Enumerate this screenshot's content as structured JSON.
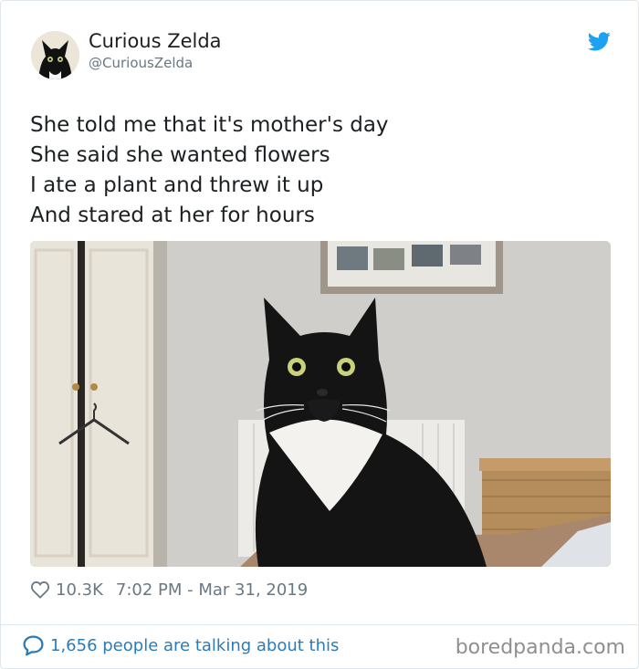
{
  "author": {
    "display_name": "Curious Zelda",
    "handle": "@CuriousZelda"
  },
  "tweet": {
    "lines": [
      "She told me that it's mother's day",
      "She said she wanted flowers",
      "I ate a plant and threw it up",
      "And stared at her for hours"
    ]
  },
  "meta": {
    "likes": "10.3K",
    "timestamp": "7:02 PM - Mar 31, 2019"
  },
  "footer": {
    "talking": "1,656 people are talking about this",
    "watermark": "boredpanda.com"
  },
  "icons": {
    "bird": "twitter-bird-icon",
    "heart": "heart-outline-icon",
    "bubble": "speech-bubble-icon"
  },
  "colors": {
    "twitter_blue": "#1da1f2",
    "link_blue": "#2b7bb9",
    "muted_text": "#697882",
    "border": "#e1e8ed"
  }
}
